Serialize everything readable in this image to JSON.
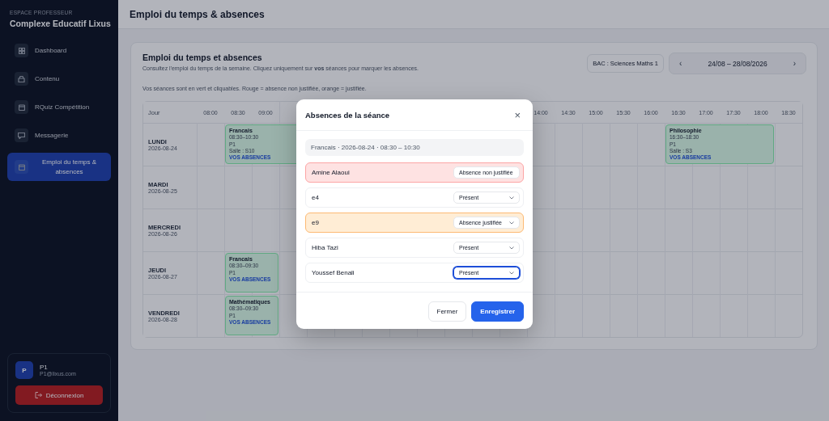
{
  "sidebar": {
    "eyebrow": "ESPACE PROFESSEUR",
    "school": "Complexe Educatif Lixus",
    "items": [
      {
        "label": "Dashboard",
        "selected": false
      },
      {
        "label": "Contenu",
        "selected": false
      },
      {
        "label": "RQuiz Compétition",
        "selected": false
      },
      {
        "label": "Messagerie",
        "selected": false
      },
      {
        "label": "Emploi du temps & absences",
        "selected": true
      }
    ],
    "user": {
      "initial": "P",
      "name": "P1",
      "email": "P1@lixus.com"
    },
    "logout": "Déconnexion"
  },
  "header": {
    "title": "Emploi du temps & absences"
  },
  "panel": {
    "title": "Emploi du temps et absences",
    "intro": "Consultez l'emploi du temps de la semaine. Cliquez uniquement sur **vos** séances pour marquer les absences.",
    "legend": "Vos séances sont en vert et cliquables. Rouge = absence non justifiée, orange = justifiée.",
    "class_select": "BAC : Sciences Maths 1",
    "week": {
      "prev": "‹",
      "range": "24/08 – 28/08/2026",
      "next": "›"
    }
  },
  "timetable": {
    "corner": "Jour",
    "time_headers_left": [
      "08:00",
      "08:30",
      "09:00"
    ],
    "time_headers_right": [
      "14:00",
      "14:30",
      "15:00",
      "15:30",
      "16:00",
      "16:30",
      "17:00",
      "17:30",
      "18:00",
      "18:30"
    ],
    "days": [
      {
        "name": "LUNDI",
        "date": "2026-08-24",
        "sessions": [
          {
            "subject": "Francais",
            "time": "08:30–10:30",
            "teacher": "P1",
            "room": "Salle : S10",
            "link": "VOS ABSENCES"
          },
          {
            "subject": "Philosophie",
            "time": "16:30–18:30",
            "teacher": "P1",
            "room": "Salle : S3",
            "link": "VOS ABSENCES"
          }
        ]
      },
      {
        "name": "MARDI",
        "date": "2026-08-25"
      },
      {
        "name": "MERCREDI",
        "date": "2026-08-26"
      },
      {
        "name": "JEUDI",
        "date": "2026-08-27",
        "sessions": [
          {
            "subject": "Francais",
            "time": "08:30–09:30",
            "teacher": "P1",
            "link": "VOS ABSENCES"
          }
        ]
      },
      {
        "name": "VENDREDI",
        "date": "2026-08-28",
        "sessions": [
          {
            "subject": "Mathématiques",
            "time": "08:30–09:30",
            "teacher": "P1",
            "link": "VOS ABSENCES"
          }
        ]
      }
    ]
  },
  "modal": {
    "title": "Absences de la séance",
    "close": "×",
    "session": "Francais · 2026-08-24 · 08:30 – 10:30",
    "students": [
      {
        "name": "Amine Alaoui",
        "status": "Absence non justifiée",
        "kind": "unjustified",
        "focused": false
      },
      {
        "name": "e4",
        "status": "Présent",
        "kind": "present",
        "focused": false
      },
      {
        "name": "e9",
        "status": "Absence justifiée",
        "kind": "justified",
        "focused": false
      },
      {
        "name": "Hiba Tazi",
        "status": "Présent",
        "kind": "present",
        "focused": false
      },
      {
        "name": "Youssef Benali",
        "status": "Présent",
        "kind": "present",
        "focused": true
      }
    ],
    "buttons": [
      {
        "label": "Fermer",
        "kind": "secondary"
      },
      {
        "label": "Enregistrer",
        "kind": "primary"
      }
    ]
  }
}
